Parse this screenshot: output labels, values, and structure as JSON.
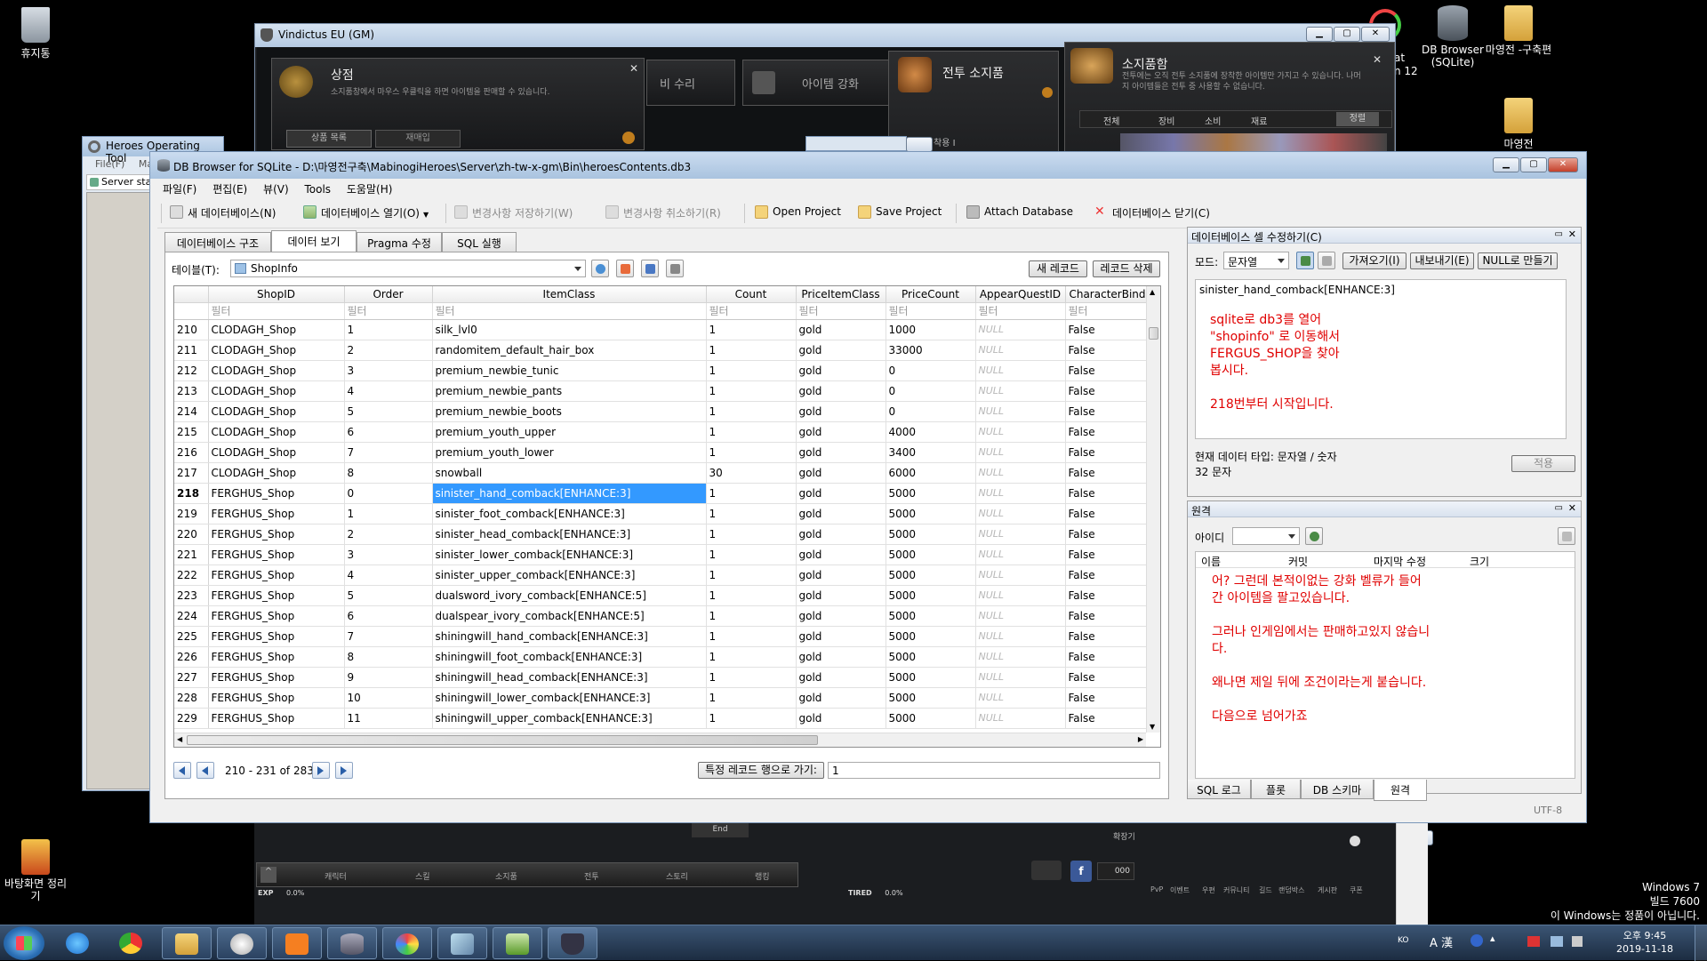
{
  "desktop": {
    "icons": [
      {
        "label": "휴지통"
      },
      {
        "label": "DB Browser (SQLite)"
      },
      {
        "label": "마영전 -구축편"
      },
      {
        "label": "마영전"
      },
      {
        "label": "바탕화면 정리기"
      }
    ],
    "partial_icon_label_1": "at",
    "partial_icon_label_2": "n 12",
    "watermark_line1": "Windows 7",
    "watermark_line2": "빌드 7600",
    "watermark_line3": "이 Windows는 정품이 아닙니다."
  },
  "game_window": {
    "title": "Vindictus EU (GM)",
    "shop_title": "상점",
    "shop_desc": "소지품창에서 마우스 우클릭을 하면 아이템을 판매할 수 있습니다.",
    "shop_tab1": "상품 목록",
    "shop_tab2": "재매입",
    "repair_label": "비 수리",
    "enhance_label": "아이템 강화",
    "battle_inventory_title": "전투 소지품",
    "inventory_title": "소지품함",
    "inventory_desc": "전투에는 오직 전투 소지품에 장착한 아이템만 가지고 수 있습니다. 나머지 아이템들은 전투 중 사용할 수 없습니다.",
    "equip_label": "착용 I",
    "filters": [
      "전체",
      "장비",
      "소비",
      "재료"
    ],
    "sort_button": "정렬",
    "end_label": "End",
    "enhance_small": "확장기",
    "bottom_menu": [
      "캐릭터",
      "스킬",
      "소지품",
      "전투",
      "스토리",
      "랭킹"
    ],
    "bottom_right": [
      "PvP",
      "이벤트",
      "우편",
      "커뮤니티",
      "길드",
      "랜덤박스",
      "게시판",
      "쿠폰"
    ],
    "exp_label": "EXP",
    "exp_value": "0.0%",
    "tired_label": "TIRED",
    "tired_value": "0.0%",
    "gold_value": "000"
  },
  "hot_window": {
    "title": "Heroes Operating Tool",
    "menu": [
      "File(F)",
      "Ma"
    ],
    "server_status": "Server sta"
  },
  "dbb": {
    "title": "DB Browser for SQLite - D:\\마영전구축\\MabinogiHeroes\\Server\\zh-tw-x-gm\\Bin\\heroesContents.db3",
    "menu": [
      "파일(F)",
      "편집(E)",
      "뷰(V)",
      "Tools",
      "도움말(H)"
    ],
    "toolbar": {
      "new_db": "새 데이터베이스(N)",
      "open_db": "데이터베이스 열기(O)",
      "write_changes": "변경사항 저장하기(W)",
      "revert_changes": "변경사항 취소하기(R)",
      "open_project": "Open Project",
      "save_project": "Save Project",
      "attach_db": "Attach Database",
      "close_db": "데이터베이스 닫기(C)"
    },
    "tabs": [
      "데이터베이스 구조",
      "데이터 보기",
      "Pragma 수정",
      "SQL 실행"
    ],
    "table_label": "테이블(T):",
    "table_value": "ShopInfo",
    "new_record": "새 레코드",
    "delete_record": "레코드 삭제",
    "columns": [
      "ShopID",
      "Order",
      "ItemClass",
      "Count",
      "PriceItemClass",
      "PriceCount",
      "AppearQuestID",
      "CharacterBind"
    ],
    "filter_placeholder": "필터",
    "rows": [
      [
        "210",
        "CLODAGH_Shop",
        "1",
        "silk_lvl0",
        "1",
        "gold",
        "1000",
        "NULL",
        "False"
      ],
      [
        "211",
        "CLODAGH_Shop",
        "2",
        "randomitem_default_hair_box",
        "1",
        "gold",
        "33000",
        "NULL",
        "False"
      ],
      [
        "212",
        "CLODAGH_Shop",
        "3",
        "premium_newbie_tunic",
        "1",
        "gold",
        "0",
        "NULL",
        "False"
      ],
      [
        "213",
        "CLODAGH_Shop",
        "4",
        "premium_newbie_pants",
        "1",
        "gold",
        "0",
        "NULL",
        "False"
      ],
      [
        "214",
        "CLODAGH_Shop",
        "5",
        "premium_newbie_boots",
        "1",
        "gold",
        "0",
        "NULL",
        "False"
      ],
      [
        "215",
        "CLODAGH_Shop",
        "6",
        "premium_youth_upper",
        "1",
        "gold",
        "4000",
        "NULL",
        "False"
      ],
      [
        "216",
        "CLODAGH_Shop",
        "7",
        "premium_youth_lower",
        "1",
        "gold",
        "3400",
        "NULL",
        "False"
      ],
      [
        "217",
        "CLODAGH_Shop",
        "8",
        "snowball",
        "30",
        "gold",
        "6000",
        "NULL",
        "False"
      ],
      [
        "218",
        "FERGHUS_Shop",
        "0",
        "sinister_hand_comback[ENHANCE:3]",
        "1",
        "gold",
        "5000",
        "NULL",
        "False"
      ],
      [
        "219",
        "FERGHUS_Shop",
        "1",
        "sinister_foot_comback[ENHANCE:3]",
        "1",
        "gold",
        "5000",
        "NULL",
        "False"
      ],
      [
        "220",
        "FERGHUS_Shop",
        "2",
        "sinister_head_comback[ENHANCE:3]",
        "1",
        "gold",
        "5000",
        "NULL",
        "False"
      ],
      [
        "221",
        "FERGHUS_Shop",
        "3",
        "sinister_lower_comback[ENHANCE:3]",
        "1",
        "gold",
        "5000",
        "NULL",
        "False"
      ],
      [
        "222",
        "FERGHUS_Shop",
        "4",
        "sinister_upper_comback[ENHANCE:3]",
        "1",
        "gold",
        "5000",
        "NULL",
        "False"
      ],
      [
        "223",
        "FERGHUS_Shop",
        "5",
        "dualsword_ivory_comback[ENHANCE:5]",
        "1",
        "gold",
        "5000",
        "NULL",
        "False"
      ],
      [
        "224",
        "FERGHUS_Shop",
        "6",
        "dualspear_ivory_comback[ENHANCE:5]",
        "1",
        "gold",
        "5000",
        "NULL",
        "False"
      ],
      [
        "225",
        "FERGHUS_Shop",
        "7",
        "shiningwill_hand_comback[ENHANCE:3]",
        "1",
        "gold",
        "5000",
        "NULL",
        "False"
      ],
      [
        "226",
        "FERGHUS_Shop",
        "8",
        "shiningwill_foot_comback[ENHANCE:3]",
        "1",
        "gold",
        "5000",
        "NULL",
        "False"
      ],
      [
        "227",
        "FERGHUS_Shop",
        "9",
        "shiningwill_head_comback[ENHANCE:3]",
        "1",
        "gold",
        "5000",
        "NULL",
        "False"
      ],
      [
        "228",
        "FERGHUS_Shop",
        "10",
        "shiningwill_lower_comback[ENHANCE:3]",
        "1",
        "gold",
        "5000",
        "NULL",
        "False"
      ],
      [
        "229",
        "FERGHUS_Shop",
        "11",
        "shiningwill_upper_comback[ENHANCE:3]",
        "1",
        "gold",
        "5000",
        "NULL",
        "False"
      ]
    ],
    "selected_row": "218",
    "pager_text": "210 - 231 of 2832",
    "goto_button": "특정 레코드 행으로 가기:",
    "goto_value": "1",
    "edit_cell": {
      "title": "데이터베이스 셀 수정하기(C)",
      "mode_label": "모드:",
      "mode_value": "문자열",
      "import_btn": "가져오기(I)",
      "export_btn": "내보내기(E)",
      "null_btn": "NULL로 만들기",
      "cell_value": "sinister_hand_comback[ENHANCE:3]",
      "note": "sqlite로 db3를 열어\n\"shopinfo\" 로 이동해서\nFERGUS_SHOP을 찾아\n봅시다.\n\n218번부터 시작입니다.",
      "type_text": "현재 데이터 타입: 문자열 / 숫자",
      "size_text": "32 문자",
      "apply_btn": "적용"
    },
    "remote": {
      "title": "원격",
      "id_label": "아이디",
      "columns": [
        "이름",
        "커밋",
        "마지막 수정",
        "크기"
      ],
      "note": "어? 그런데  본적이없는 강화 벨류가 들어\n간 아이템을 팔고있습니다.\n\n그러나 인게임에서는 판매하고있지 않습니\n다.\n\n왜나면 제일 뒤에 조건이라는게 붙습니다.\n\n다음으로 넘어가죠"
    },
    "bottom_tabs": [
      "SQL 로그",
      "플롯",
      "DB 스키마",
      "원격"
    ],
    "encoding": "UTF-8"
  },
  "taskbar": {
    "clock_time": "오후 9:45",
    "clock_date": "2019-11-18",
    "lang": "KO",
    "ime": "A 漢"
  }
}
